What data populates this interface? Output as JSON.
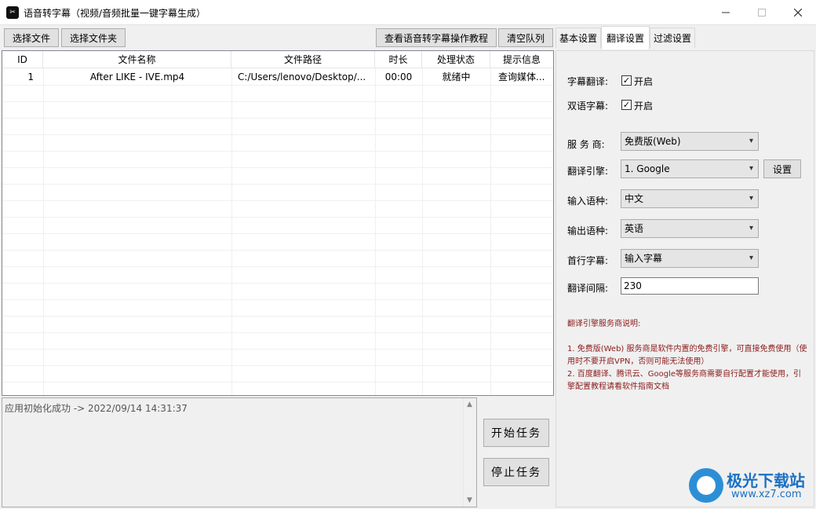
{
  "window": {
    "title": "语音转字幕（视频/音频批量一键字幕生成）"
  },
  "toolbar": {
    "select_file": "选择文件",
    "select_folder": "选择文件夹",
    "tutorial": "查看语音转字幕操作教程",
    "clear_queue": "清空队列"
  },
  "tabs": [
    {
      "label": "基本设置",
      "active": false
    },
    {
      "label": "翻译设置",
      "active": true
    },
    {
      "label": "过滤设置",
      "active": false
    }
  ],
  "table": {
    "headers": {
      "id": "ID",
      "name": "文件名称",
      "path": "文件路径",
      "duration": "时长",
      "status": "处理状态",
      "info": "提示信息"
    },
    "rows": [
      {
        "id": "1",
        "name": "After LIKE - IVE.mp4",
        "path": "C:/Users/lenovo/Desktop/...",
        "duration": "00:00",
        "status": "就绪中",
        "info": "查询媒体..."
      }
    ]
  },
  "log": {
    "text": "应用初始化成功  ->   2022/09/14 14:31:37"
  },
  "actions": {
    "start": "开始任务",
    "stop": "停止任务"
  },
  "settings": {
    "subtitle_translate_label": "字幕翻译:",
    "subtitle_translate_value": "开启",
    "subtitle_translate_checked": true,
    "bilingual_label": "双语字幕:",
    "bilingual_value": "开启",
    "bilingual_checked": true,
    "provider_label": "服 务 商:",
    "provider_value": "免费版(Web)",
    "engine_label": "翻译引擎:",
    "engine_value": "1. Google",
    "engine_settings": "设置",
    "input_lang_label": "输入语种:",
    "input_lang_value": "中文",
    "output_lang_label": "输出语种:",
    "output_lang_value": "英语",
    "first_line_label": "首行字幕:",
    "first_line_value": "输入字幕",
    "interval_label": "翻译间隔:",
    "interval_value": "230"
  },
  "notes": {
    "title": "翻译引擎服务商说明:",
    "line1": "1. 免费版(Web) 服务商是软件内置的免费引擎，可直接免费使用（使用时不要开启VPN，否则可能无法使用）",
    "line2": "2. 百度翻译、腾讯云、Google等服务商需要自行配置才能使用，引擎配置教程请看软件指南文档"
  },
  "watermark": {
    "name": "极光下载站",
    "url": "www.xz7.com"
  }
}
